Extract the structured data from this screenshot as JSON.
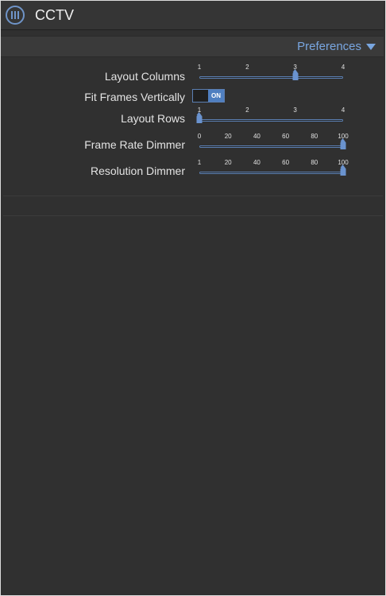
{
  "app": {
    "title": "CCTV",
    "icon": "menu-icon"
  },
  "subbar": {
    "preferences_label": "Preferences"
  },
  "settings": {
    "layout_columns": {
      "label": "Layout Columns",
      "ticks": [
        "1",
        "2",
        "3",
        "4"
      ],
      "value": 3,
      "min": 1,
      "max": 4
    },
    "fit_frames_vertically": {
      "label": "Fit Frames Vertically",
      "state": "ON"
    },
    "layout_rows": {
      "label": "Layout Rows",
      "ticks": [
        "1",
        "2",
        "3",
        "4"
      ],
      "value": 1,
      "min": 1,
      "max": 4
    },
    "frame_rate_dimmer": {
      "label": "Frame Rate Dimmer",
      "ticks": [
        "0",
        "20",
        "40",
        "60",
        "80",
        "100"
      ],
      "value": 100,
      "min": 0,
      "max": 100
    },
    "resolution_dimmer": {
      "label": "Resolution Dimmer",
      "ticks": [
        "1",
        "20",
        "40",
        "60",
        "80",
        "100"
      ],
      "value": 100,
      "min": 1,
      "max": 100
    }
  },
  "colors": {
    "accent": "#6a93cf",
    "link": "#79a6e0",
    "background": "#303030"
  }
}
